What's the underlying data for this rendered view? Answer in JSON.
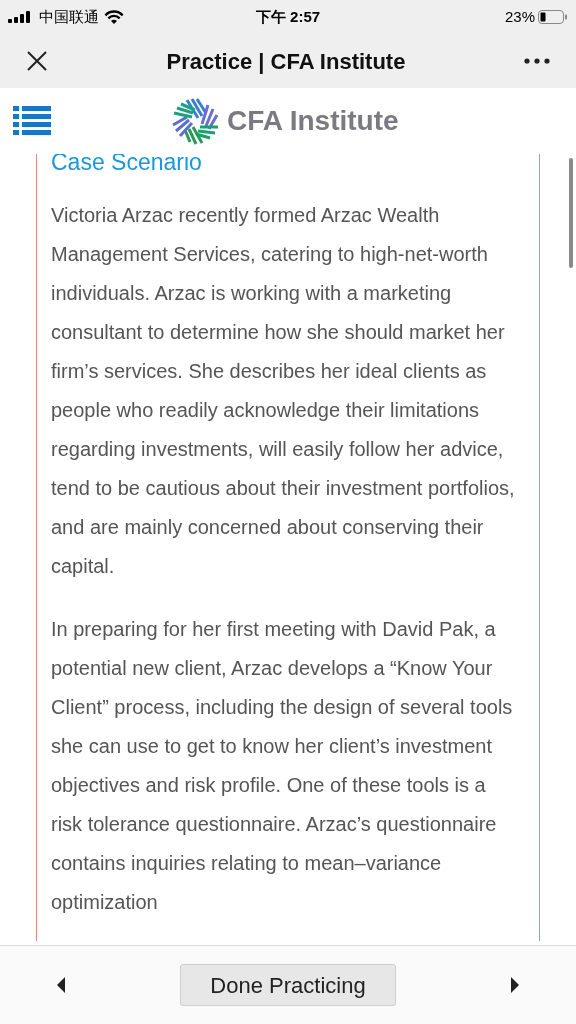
{
  "status_bar": {
    "carrier": "中国联通",
    "time": "下午 2:57",
    "battery": "23%"
  },
  "nav_bar": {
    "title": "Practice | CFA Institute"
  },
  "header": {
    "logo_text": "CFA Institute"
  },
  "content": {
    "heading": "Case Scenario",
    "paragraphs": [
      "Victoria Arzac recently formed Arzac Wealth Management Services, catering to high-net-worth individuals. Arzac is working with a marketing consultant to determine how she should market her firm’s services. She describes her ideal clients as people who readily acknowledge their limitations regarding investments, will easily follow her advice, tend to be cautious about their investment portfolios, and are mainly concerned about conserving their capital.",
      "In preparing for her first meeting with David Pak, a potential new client, Arzac develops a “Know Your Client” process, including the design of several tools she can use to get to know her client’s investment objectives and risk profile. One of these tools is a risk tolerance questionnaire. Arzac’s questionnaire contains inquiries relating to mean–variance optimization"
    ]
  },
  "footer": {
    "button": "Done Practicing"
  }
}
